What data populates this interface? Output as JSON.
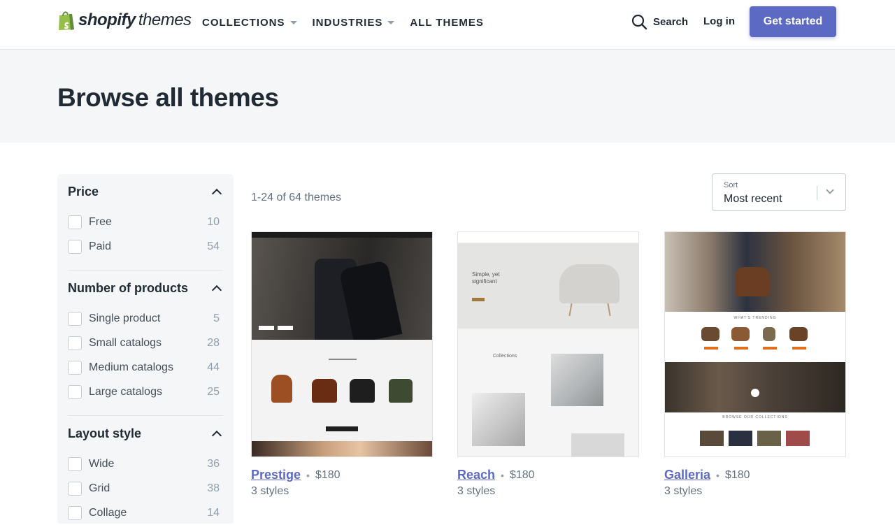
{
  "header": {
    "logo_bold": "shopify",
    "logo_light": "themes",
    "nav": [
      {
        "label": "COLLECTIONS",
        "has_caret": true
      },
      {
        "label": "INDUSTRIES",
        "has_caret": true
      },
      {
        "label": "ALL THEMES",
        "has_caret": false
      }
    ],
    "search_label": "Search",
    "login_label": "Log in",
    "cta_label": "Get started"
  },
  "hero": {
    "title": "Browse all themes"
  },
  "filters": {
    "groups": [
      {
        "title": "Price",
        "options": [
          {
            "label": "Free",
            "count": "10"
          },
          {
            "label": "Paid",
            "count": "54"
          }
        ]
      },
      {
        "title": "Number of products",
        "options": [
          {
            "label": "Single product",
            "count": "5"
          },
          {
            "label": "Small catalogs",
            "count": "28"
          },
          {
            "label": "Medium catalogs",
            "count": "44"
          },
          {
            "label": "Large catalogs",
            "count": "25"
          }
        ]
      },
      {
        "title": "Layout style",
        "options": [
          {
            "label": "Wide",
            "count": "36"
          },
          {
            "label": "Grid",
            "count": "38"
          },
          {
            "label": "Collage",
            "count": "14"
          }
        ]
      }
    ]
  },
  "results": {
    "count_text": "1-24 of 64 themes",
    "sort_label": "Sort",
    "sort_value": "Most recent"
  },
  "themes": [
    {
      "name": "Prestige",
      "price": "$180",
      "styles": "3 styles"
    },
    {
      "name": "Reach",
      "price": "$180",
      "styles": "3 styles"
    },
    {
      "name": "Galleria",
      "price": "$180",
      "styles": "3 styles"
    }
  ],
  "thumbs": {
    "reach_heading": "Simple, yet significant",
    "reach_collections": "Collections",
    "galleria_trending": "WHAT'S TRENDING",
    "galleria_collections": "BROWSE OUR COLLECTIONS"
  },
  "colors": {
    "accent": "#5c6ac4",
    "logo_green": "#95bf47",
    "hero_bg": "#f4f6f8"
  }
}
